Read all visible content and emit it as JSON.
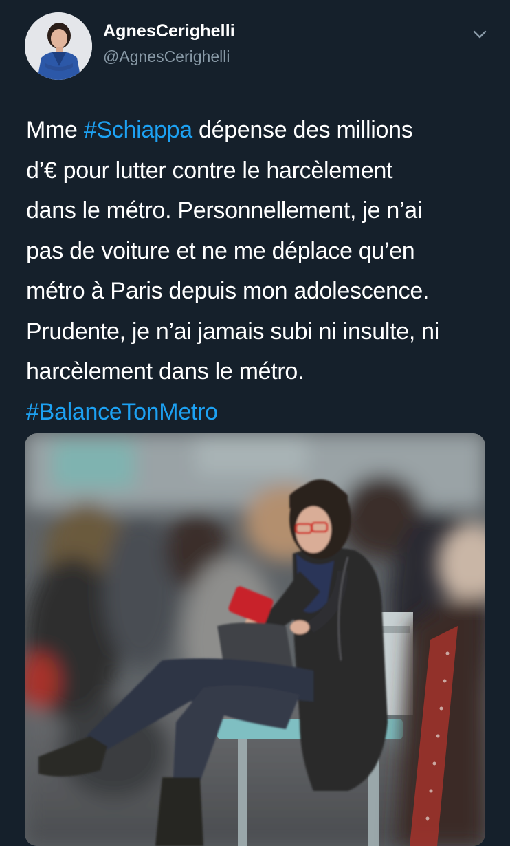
{
  "tweet": {
    "author_name": "AgnesCerighelli",
    "author_handle": "@AgnesCerighelli",
    "body": {
      "line1_prefix": "Mme ",
      "hashtag1": "#Schiappa",
      "line1_suffix": " dépense des millions",
      "line2": "d’€ pour lutter contre le harcèlement",
      "line3": "dans le métro. Personnellement, je n’ai",
      "line4": "pas de voiture et ne me déplace qu’en",
      "line5": "métro à Paris depuis mon adolescence.",
      "line6": "Prudente, je n’ai jamais subi ni insulte, ni",
      "line7": "harcèlement dans le métro.",
      "hashtag2": "#BalanceTonMetro"
    },
    "icons": {
      "menu": "chevron-down-icon"
    }
  },
  "colors": {
    "background": "#15202b",
    "hashtag": "#1da1f2",
    "secondary_text": "#8899a6"
  }
}
